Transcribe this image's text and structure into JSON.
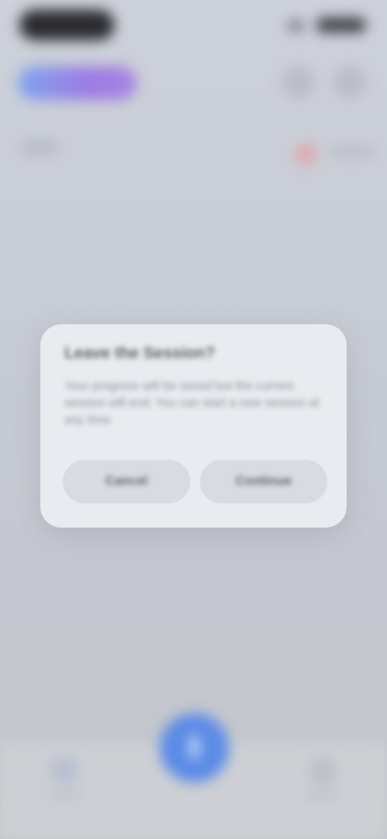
{
  "screen": {
    "background_color": "#c9cdd6",
    "overlay": "blurred-background"
  },
  "header": {
    "action_pill_icon": "gradient-pill",
    "icons": [
      "header-circle-icon",
      "header-circle-icon"
    ],
    "indicator_icon": "red-dot-icon"
  },
  "dialog": {
    "title": "Leave the Session?",
    "message": "Your progress will be saved but the current session will end. You can start a new session at any time.",
    "cancel_label": "Cancel",
    "continue_label": "Continue"
  },
  "bottom_nav": {
    "left_icon": "person-icon",
    "center_icon": "fab-circle-icon",
    "right_icon": "grid-icon"
  },
  "colors": {
    "accent_gradient_start": "#7fa4ee",
    "accent_gradient_end": "#a985e6",
    "fab": "#5b8be6",
    "indicator": "#e3a6ac",
    "dialog_surface": "#e8ebef"
  }
}
